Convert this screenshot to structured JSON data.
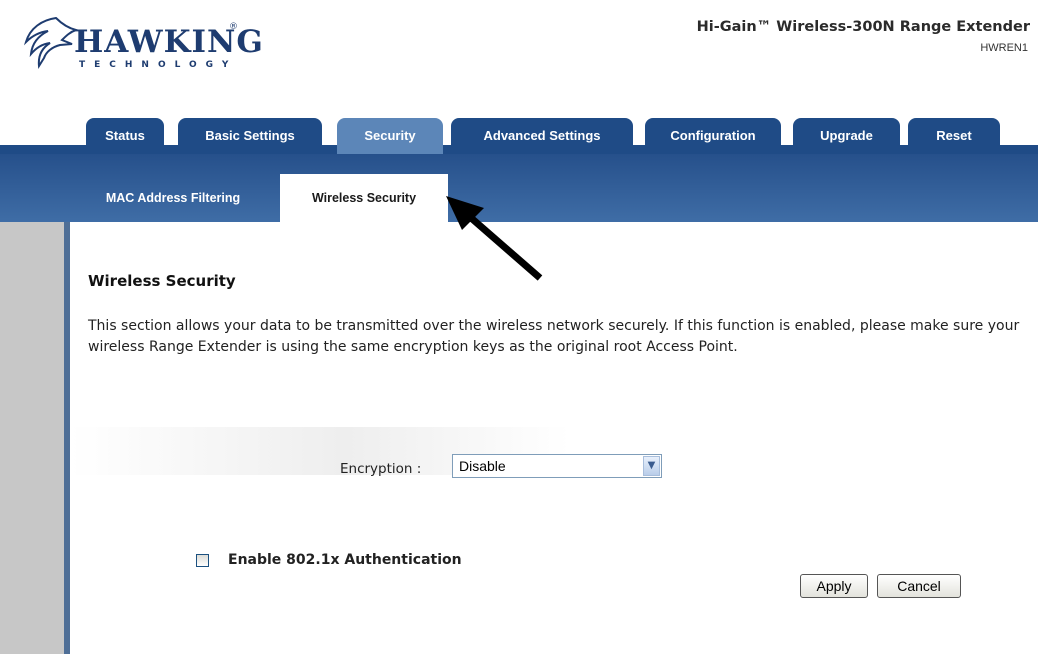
{
  "header": {
    "brand": "HAWKING",
    "brand_reg": "®",
    "brand_sub": "TECHNOLOGY",
    "product_title": "Hi-Gain™ Wireless-300N Range Extender",
    "model": "HWREN1"
  },
  "tabs": [
    {
      "label": "Status"
    },
    {
      "label": "Basic Settings"
    },
    {
      "label": "Security",
      "active": true
    },
    {
      "label": "Advanced Settings"
    },
    {
      "label": "Configuration"
    },
    {
      "label": "Upgrade"
    },
    {
      "label": "Reset"
    }
  ],
  "subtabs": [
    {
      "label": "MAC Address Filtering"
    },
    {
      "label": "Wireless Security",
      "active": true
    }
  ],
  "main": {
    "title": "Wireless Security",
    "description": "This section allows your data to be transmitted over the wireless network securely. If this function is enabled, please make sure your wireless Range Extender is using the same encryption keys as the original root Access Point.",
    "encryption_label": "Encryption :",
    "encryption_value": "Disable",
    "checkbox_label": "Enable 802.1x Authentication",
    "checkbox_checked": false,
    "apply_label": "Apply",
    "cancel_label": "Cancel"
  },
  "colors": {
    "tab": "#1f4b86",
    "tab_active": "#5c86b8",
    "brand": "#1e3c70"
  }
}
